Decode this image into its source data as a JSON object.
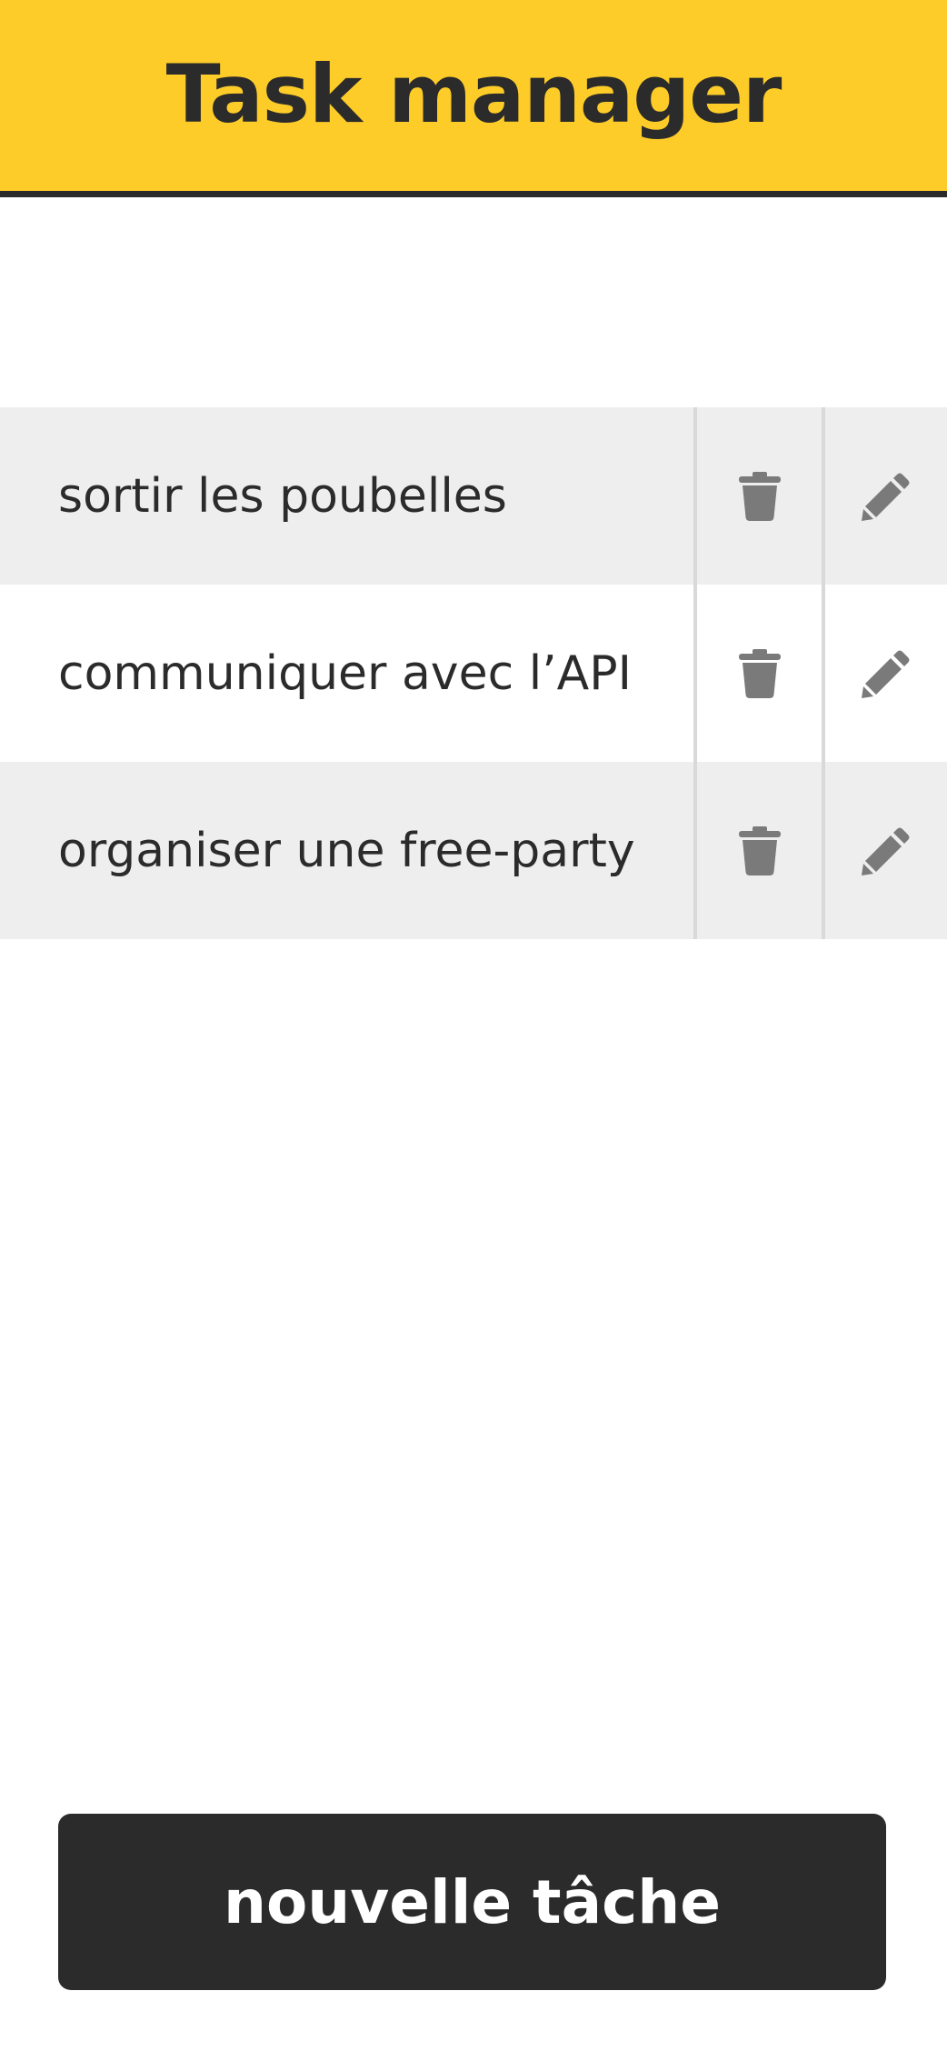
{
  "header": {
    "title": "Task manager"
  },
  "tasks": [
    {
      "label": "sortir les poubelles",
      "delete_icon": "trash-icon",
      "edit_icon": "pencil-icon"
    },
    {
      "label": "communiquer avec l’API",
      "delete_icon": "trash-icon",
      "edit_icon": "pencil-icon"
    },
    {
      "label": "organiser une free-party",
      "delete_icon": "trash-icon",
      "edit_icon": "pencil-icon"
    }
  ],
  "actions": {
    "new_task_label": "nouvelle tâche"
  },
  "colors": {
    "header_background": "#fdcc29",
    "text_dark": "#2b2b2b",
    "row_shaded": "#eeeeee",
    "icon_gray": "#7a7a7a",
    "button_background": "#2b2b2b",
    "button_text": "#ffffff"
  }
}
